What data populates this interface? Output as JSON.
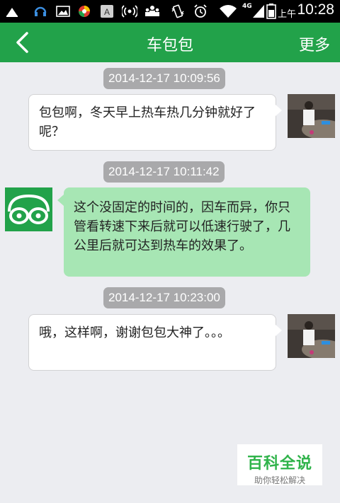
{
  "status_bar": {
    "network": "4G",
    "ampm": "上午",
    "time": "10:28",
    "icons": [
      "usb-icon",
      "headset-icon",
      "image-icon",
      "app-icon",
      "keyboard-a-icon",
      "wifi-hotspot-icon",
      "people-icon",
      "vibrate-icon",
      "alarm-icon",
      "wifi-icon",
      "signal-icon",
      "battery-icon"
    ]
  },
  "nav": {
    "back_icon": "back-arrow-icon",
    "title": "车包包",
    "more_label": "更多"
  },
  "messages": [
    {
      "timestamp": "2014-12-17 10:09:56",
      "side": "right",
      "avatar": "user-photo-avatar",
      "text": "包包啊，冬天早上热车热几分钟就好了呢？"
    },
    {
      "timestamp": "2014-12-17 10:11:42",
      "side": "left",
      "avatar": "car-bot-avatar",
      "text": "这个没固定的时间的，因车而异，你只管看转速下来后就可以低速行驶了，几公里后就可达到热车的效果了。"
    },
    {
      "timestamp": "2014-12-17 10:23:00",
      "side": "right",
      "avatar": "user-photo-avatar",
      "text": "哦，这样啊，谢谢包包大神了。。。"
    }
  ],
  "watermark": {
    "title": "百科全说",
    "subtitle": "助你轻松解决"
  },
  "colors": {
    "nav_green": "#22a24a",
    "incoming_bubble": "#a7e6b4",
    "timestamp_bg": "#a9a9ab",
    "background": "#ecedf1"
  }
}
